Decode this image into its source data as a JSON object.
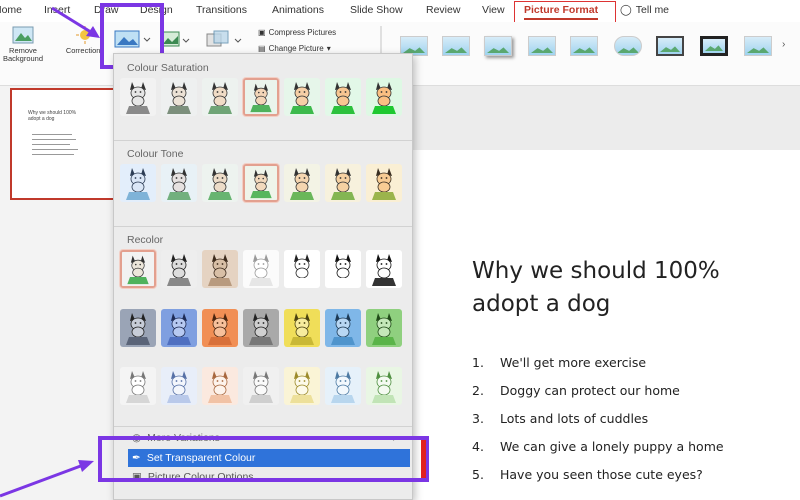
{
  "ribbon_tabs": [
    "Home",
    "Insert",
    "Draw",
    "Design",
    "Transitions",
    "Animations",
    "Slide Show",
    "Review",
    "View",
    "Picture Format",
    "Tell me"
  ],
  "ribbon": {
    "remove_background": "Remove Background",
    "corrections": "Corrections",
    "compress_pictures": "Compress Pictures",
    "change_picture": "Change Picture"
  },
  "dropdown": {
    "section_saturation": "Colour Saturation",
    "section_tone": "Colour Tone",
    "section_recolor": "Recolor",
    "more_variations": "More Variations",
    "set_transparent": "Set Transparent Colour",
    "picture_colour_options": "Picture Colour Options"
  },
  "thumbnail": {
    "title": "Why we should 100% adopt a dog"
  },
  "slide": {
    "title": "Why we should 100% adopt a dog",
    "bullets": [
      {
        "num": "1.",
        "text": "We'll get more exercise"
      },
      {
        "num": "2.",
        "text": "Doggy can protect our home"
      },
      {
        "num": "3.",
        "text": "Lots and lots of cuddles"
      },
      {
        "num": "4.",
        "text": "We can give a lonely puppy a home"
      },
      {
        "num": "5.",
        "text": "Have you seen those cute eyes?"
      }
    ]
  },
  "colors": {
    "accent": "#c0392b",
    "highlight": "#2f73da",
    "annotation": "#7b36e4"
  }
}
